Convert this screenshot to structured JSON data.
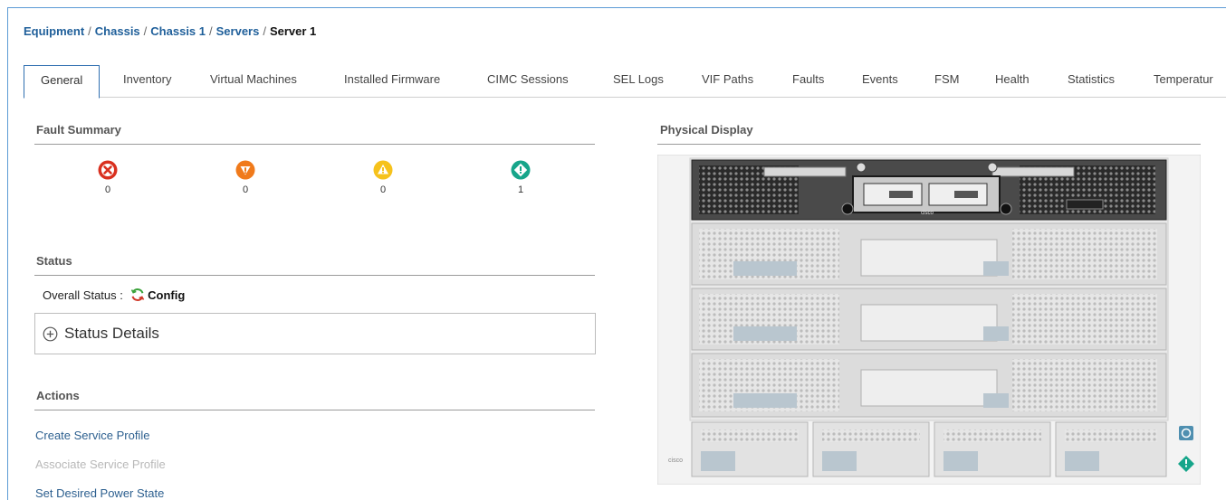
{
  "breadcrumb": {
    "items": [
      "Equipment",
      "Chassis",
      "Chassis 1",
      "Servers"
    ],
    "current": "Server 1",
    "separator": "/"
  },
  "tabs": [
    {
      "label": "General",
      "active": true
    },
    {
      "label": "Inventory"
    },
    {
      "label": "Virtual Machines"
    },
    {
      "label": "Installed Firmware"
    },
    {
      "label": "CIMC Sessions"
    },
    {
      "label": "SEL Logs"
    },
    {
      "label": "VIF Paths"
    },
    {
      "label": "Faults"
    },
    {
      "label": "Events"
    },
    {
      "label": "FSM"
    },
    {
      "label": "Health"
    },
    {
      "label": "Statistics"
    },
    {
      "label": "Temperatur"
    }
  ],
  "fault_summary": {
    "title": "Fault Summary",
    "items": [
      {
        "icon": "critical-fault-icon",
        "count": "0",
        "color": "#d9301f"
      },
      {
        "icon": "major-fault-icon",
        "count": "0",
        "color": "#f07a1b"
      },
      {
        "icon": "minor-fault-icon",
        "count": "0",
        "color": "#f6c21c"
      },
      {
        "icon": "warning-fault-icon",
        "count": "1",
        "color": "#16a58a"
      }
    ]
  },
  "status": {
    "title": "Status",
    "overall_label": "Overall Status :",
    "overall_value": "Config",
    "details_label": "Status Details"
  },
  "actions": {
    "title": "Actions",
    "items": [
      {
        "label": "Create Service Profile",
        "enabled": true
      },
      {
        "label": "Associate Service Profile",
        "enabled": false
      },
      {
        "label": "Set Desired Power State",
        "enabled": true
      }
    ]
  },
  "physical_display": {
    "title": "Physical Display",
    "brand": "cisco"
  }
}
